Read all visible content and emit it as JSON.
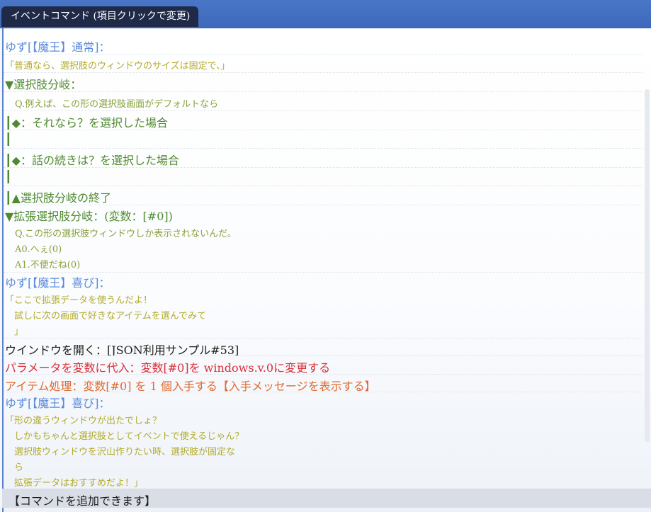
{
  "window": {
    "title": "イベントコマンド (項目クリックで変更)"
  },
  "commands": [
    {
      "text": "ゆず[【魔王】通常]："
    },
    {
      "text": "「普通なら、選択肢のウィンドウのサイズは固定で、」"
    },
    {
      "text": "▼選択肢分岐："
    },
    {
      "text": "Q.例えば、この形の選択肢画面がデフォルトなら"
    },
    {
      "text": "┃◆：それなら？を選択した場合"
    },
    {
      "text": "┃"
    },
    {
      "text": "┃◆：話の続きは？を選択した場合"
    },
    {
      "text": "┃"
    },
    {
      "text": "┃▲選択肢分岐の終了"
    },
    {
      "text": "▼拡張選択肢分岐：(変数：[#0])"
    },
    {
      "text": "Q.この形の選択肢ウィンドウしか表示されないんだ。"
    },
    {
      "text": "A0.へぇ(0)"
    },
    {
      "text": "A1.不便だね(0)"
    },
    {
      "text": "ゆず[【魔王】喜び]："
    },
    {
      "text": "「ここで拡張データを使うんだよ！"
    },
    {
      "text": "　試しに次の画面で好きなアイテムを選んでみて"
    },
    {
      "text": "　」"
    },
    {
      "text": "ウインドウを開く：[JSON利用サンプル#53]"
    },
    {
      "text": "パラメータを変数に代入：変数[#0]を windows.v.0に変更する"
    },
    {
      "text": "アイテム処理：変数[#0] を 1 個入手する【入手メッセージを表示する】"
    },
    {
      "text": "ゆず[【魔王】喜び]："
    },
    {
      "text": "「形の違うウィンドウが出たでしょ？"
    },
    {
      "text": "　しかもちゃんと選択肢としてイベントで使えるじゃん？"
    },
    {
      "text": "　選択肢ウィンドウを沢山作りたい時、選択肢が固定な"
    },
    {
      "text": "　ら"
    },
    {
      "text": "　拡張データはおすすめだよ！」"
    }
  ],
  "add_command": {
    "label": "【コマンドを追加できます】"
  },
  "colors": {
    "titlebar": "#3d68bb",
    "speaker": "#5b8bdc",
    "message": "#b3ab2a",
    "branch": "#4f8a30",
    "param": "#d8303a",
    "item": "#e06a2f"
  }
}
